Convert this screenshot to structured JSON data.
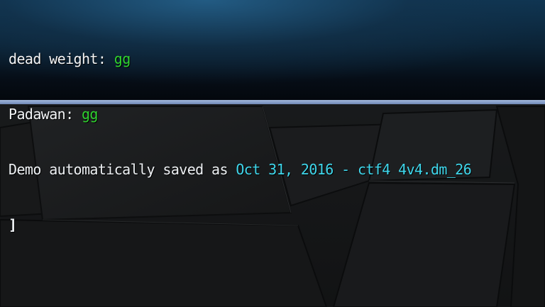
{
  "console": {
    "lines": [
      {
        "sender": "dead weight",
        "separator": ": ",
        "message": "gg",
        "message_color": "#2fd12f"
      },
      {
        "sender": "Padawan",
        "separator": ": ",
        "message": "gg",
        "message_color": "#2fd12f"
      },
      {
        "prefix": "Demo automatically saved as ",
        "filename": "Oct 31, 2016 - ctf4 4v4.dm_26",
        "filename_color": "#3fd7ec"
      }
    ],
    "input_prompt": "]"
  },
  "colors": {
    "console_top": "#0f3552",
    "console_border": "#8aa2cc",
    "background": "#151617"
  }
}
